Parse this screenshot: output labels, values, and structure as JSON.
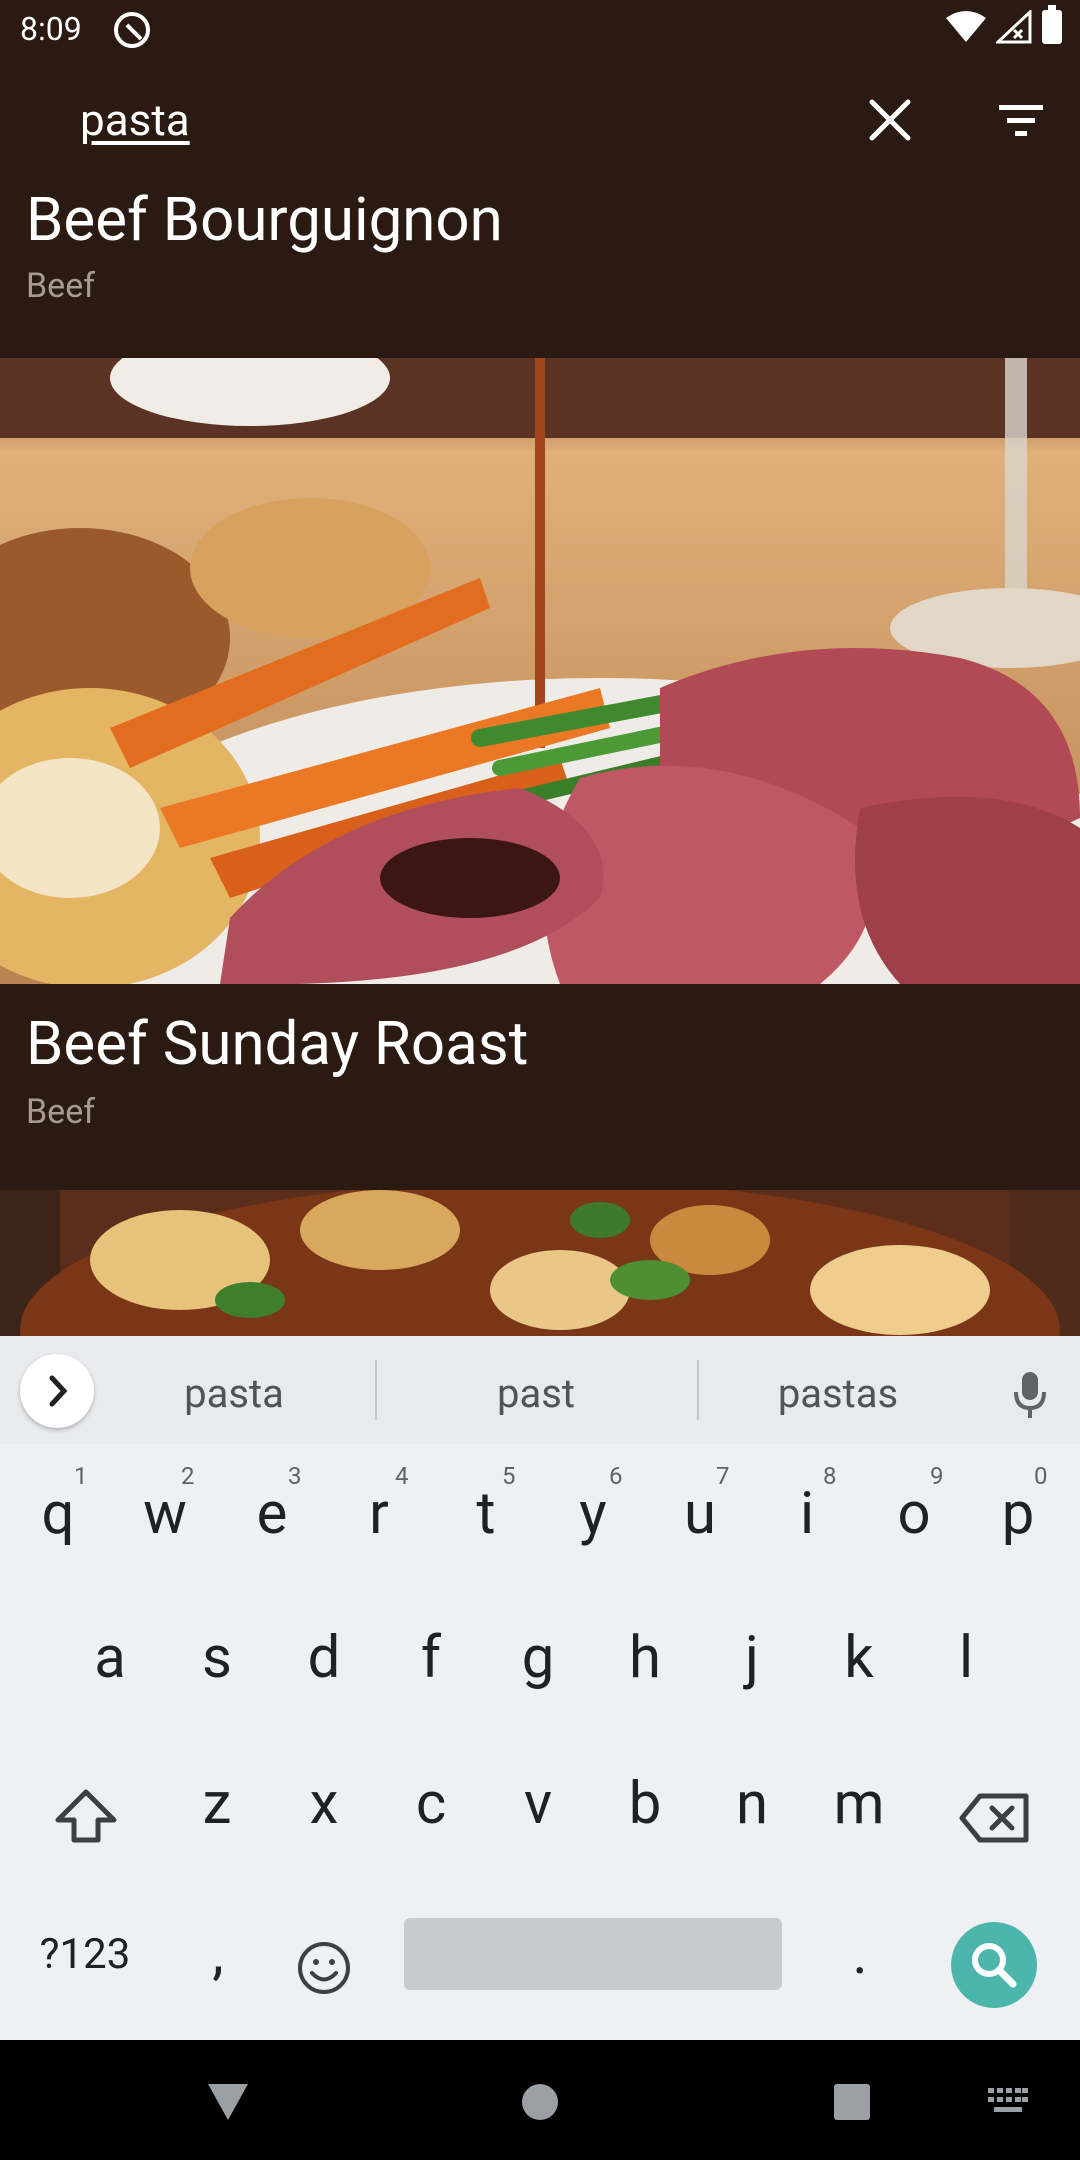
{
  "status_bar": {
    "time": "8:09"
  },
  "toolbar": {
    "search_query": "pasta"
  },
  "results": [
    {
      "title": "Beef Bourguignon",
      "category": "Beef"
    },
    {
      "title": "Beef Sunday Roast",
      "category": "Beef"
    }
  ],
  "keyboard": {
    "suggestions": [
      "pasta",
      "past",
      "pastas"
    ],
    "row1": [
      {
        "key": "q",
        "hint": "1"
      },
      {
        "key": "w",
        "hint": "2"
      },
      {
        "key": "e",
        "hint": "3"
      },
      {
        "key": "r",
        "hint": "4"
      },
      {
        "key": "t",
        "hint": "5"
      },
      {
        "key": "y",
        "hint": "6"
      },
      {
        "key": "u",
        "hint": "7"
      },
      {
        "key": "i",
        "hint": "8"
      },
      {
        "key": "o",
        "hint": "9"
      },
      {
        "key": "p",
        "hint": "0"
      }
    ],
    "row2": [
      "a",
      "s",
      "d",
      "f",
      "g",
      "h",
      "j",
      "k",
      "l"
    ],
    "row3": [
      "z",
      "x",
      "c",
      "v",
      "b",
      "n",
      "m"
    ],
    "symbols_key": "?123",
    "comma_key": ",",
    "period_key": "."
  },
  "colors": {
    "bg": "#2a1a12",
    "accent": "#4db6ac"
  }
}
